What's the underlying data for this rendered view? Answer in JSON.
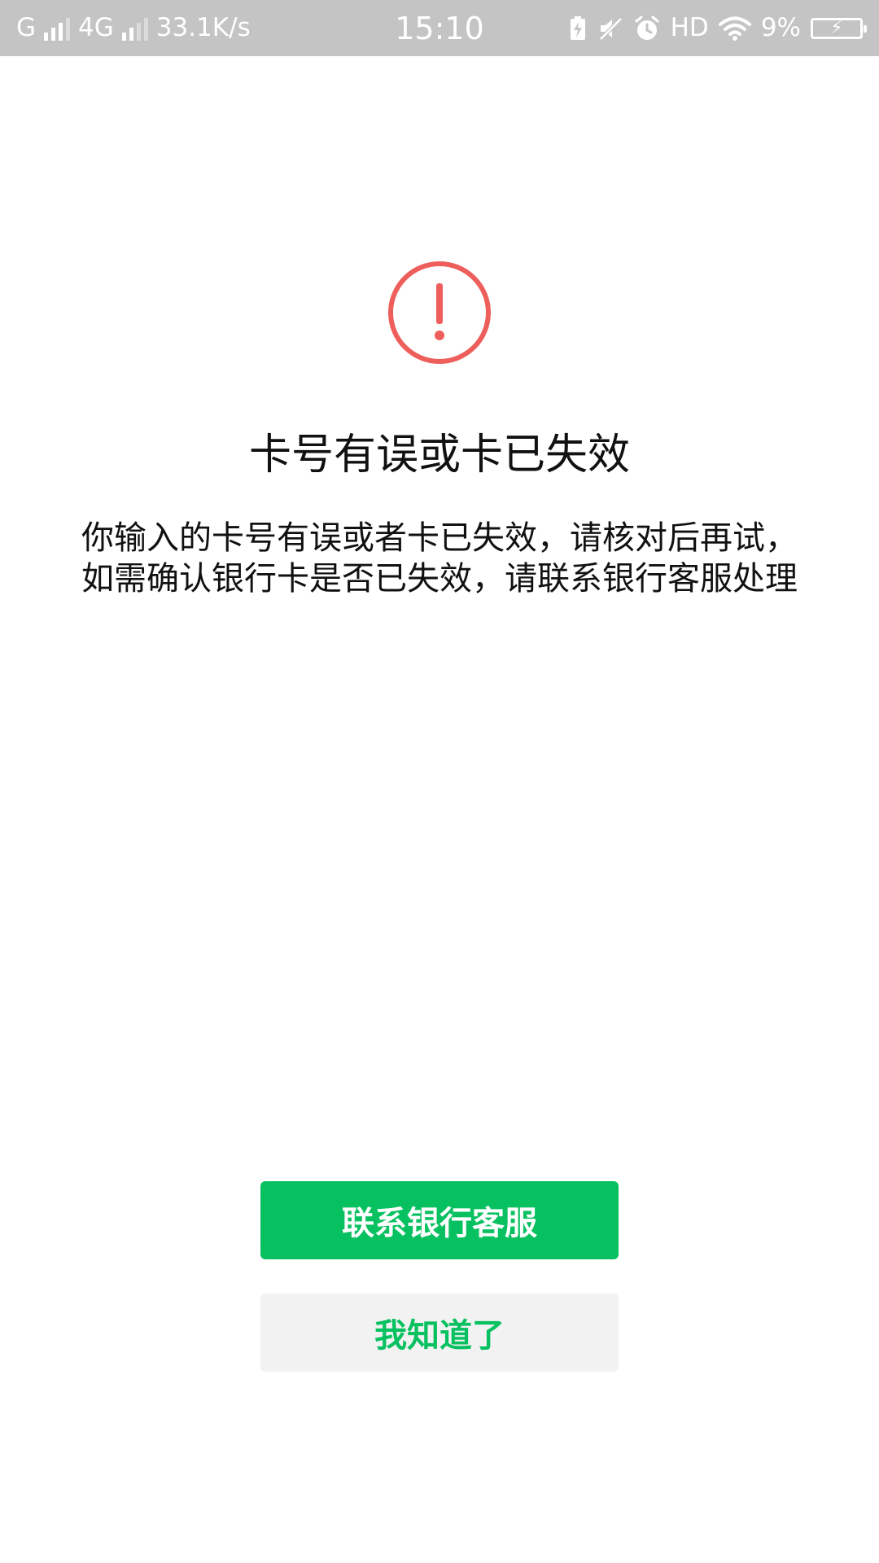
{
  "status_bar": {
    "network1": "G",
    "network2": "4G",
    "speed": "33.1K/s",
    "time": "15:10",
    "hd": "HD",
    "battery": "9%"
  },
  "icon": {
    "name": "warning-icon",
    "color": "#ee5f5b"
  },
  "title": "卡号有误或卡已失效",
  "description": {
    "line1": "你输入的卡号有误或者卡已失效，请核对后再试，",
    "line2": "如需确认银行卡是否已失效，请联系银行客服处理"
  },
  "buttons": {
    "primary_label": "联系银行客服",
    "secondary_label": "我知道了"
  },
  "colors": {
    "primary": "#07c160",
    "secondary_bg": "#f2f2f2",
    "status_bar_bg": "#c4c4c4"
  }
}
